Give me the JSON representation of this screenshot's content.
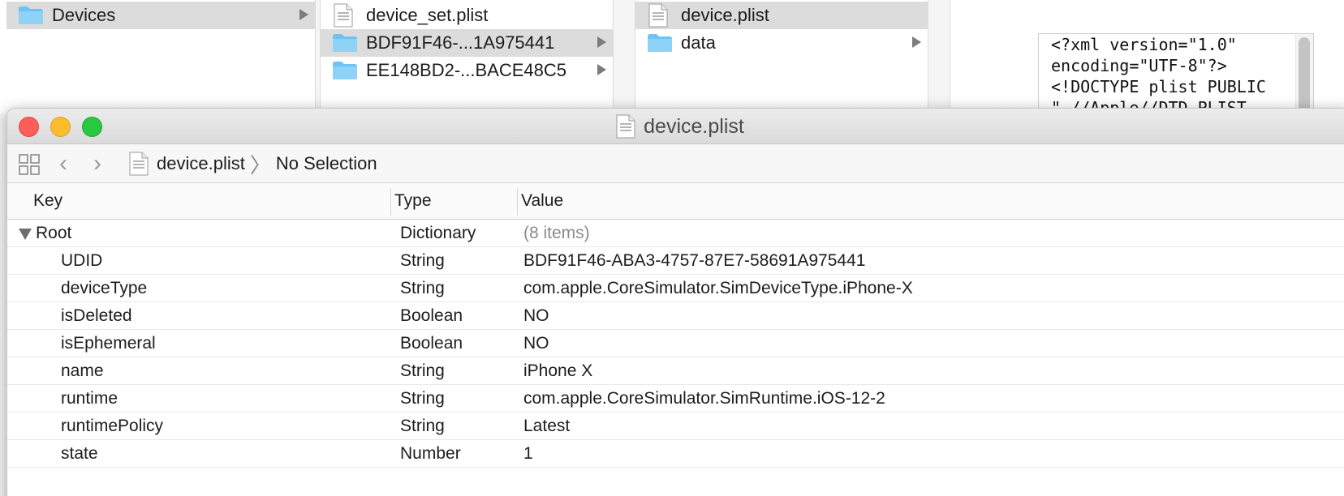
{
  "finder": {
    "column1": {
      "items": [
        {
          "label": "Devices",
          "kind": "folder",
          "selected": true,
          "has_children": true
        }
      ]
    },
    "column2": {
      "items": [
        {
          "label": "device_set.plist",
          "kind": "plist",
          "selected": false,
          "has_children": false
        },
        {
          "label": "BDF91F46-...1A975441",
          "kind": "folder",
          "selected": true,
          "has_children": true
        },
        {
          "label": "EE148BD2-...BACE48C5",
          "kind": "folder",
          "selected": false,
          "has_children": true
        }
      ]
    },
    "column3": {
      "items": [
        {
          "label": "device.plist",
          "kind": "plist",
          "selected": true,
          "has_children": false
        },
        {
          "label": "data",
          "kind": "folder",
          "selected": false,
          "has_children": true
        }
      ]
    },
    "preview_lines": [
      "<?xml version=\"1.0\"",
      "encoding=\"UTF-8\"?>",
      "<!DOCTYPE plist PUBLIC",
      "\"-//Apple//DTD PLIST"
    ]
  },
  "window": {
    "title": "device.plist",
    "breadcrumb": {
      "file": "device.plist",
      "selection": "No Selection"
    }
  },
  "table": {
    "headers": {
      "key": "Key",
      "type": "Type",
      "value": "Value"
    },
    "root": {
      "key": "Root",
      "type": "Dictionary",
      "value": "(8 items)"
    },
    "rows": [
      {
        "key": "UDID",
        "type": "String",
        "value": "BDF91F46-ABA3-4757-87E7-58691A975441"
      },
      {
        "key": "deviceType",
        "type": "String",
        "value": "com.apple.CoreSimulator.SimDeviceType.iPhone-X"
      },
      {
        "key": "isDeleted",
        "type": "Boolean",
        "value": "NO"
      },
      {
        "key": "isEphemeral",
        "type": "Boolean",
        "value": "NO"
      },
      {
        "key": "name",
        "type": "String",
        "value": "iPhone X"
      },
      {
        "key": "runtime",
        "type": "String",
        "value": "com.apple.CoreSimulator.SimRuntime.iOS-12-2"
      },
      {
        "key": "runtimePolicy",
        "type": "String",
        "value": "Latest"
      },
      {
        "key": "state",
        "type": "Number",
        "value": "1"
      }
    ]
  },
  "colors": {
    "folder": "#6ec3f3",
    "close": "#fc5f57",
    "minimize": "#fdbc2e",
    "zoom": "#28c840"
  }
}
